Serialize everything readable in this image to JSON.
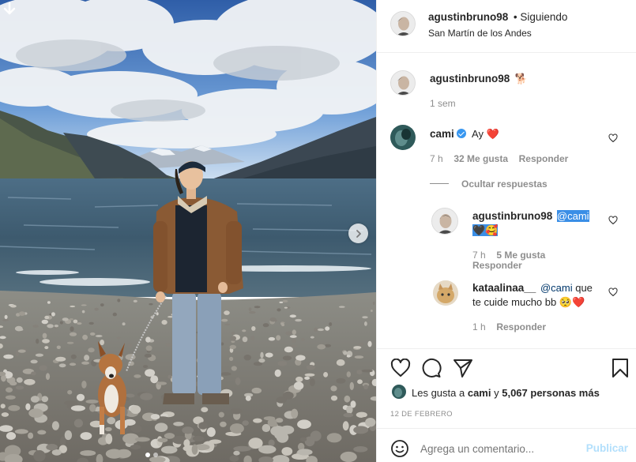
{
  "post": {
    "username": "agustinbruno98",
    "follow_status": "• Siguiendo",
    "location": "San Martín de los Andes",
    "caption_emoji": "🐕",
    "caption_time": "1 sem"
  },
  "comments": [
    {
      "username": "cami",
      "verified": true,
      "text": "Ay",
      "emoji": "❤️",
      "time": "7 h",
      "likes": "32 Me gusta",
      "reply_label": "Responder"
    }
  ],
  "hide_replies_label": "Ocultar respuestas",
  "replies": [
    {
      "username": "agustinbruno98",
      "mention": "@cami",
      "emoji": "🖤🥰",
      "time": "7 h",
      "likes": "5 Me gusta",
      "reply_label": "Responder"
    },
    {
      "username": "kataalinaa__",
      "mention": "@cami",
      "text_line1_suffix": "que",
      "text_line2": "te cuide mucho bb",
      "emoji": "🥺❤️",
      "time": "1 h",
      "reply_label": "Responder"
    }
  ],
  "likes_line": {
    "prefix": "Les gusta a",
    "first_user": "cami",
    "middle": "y",
    "others": "5,067 personas más"
  },
  "date": "12 DE FEBRERO",
  "comment_input": {
    "placeholder": "Agrega un comentario...",
    "publish_label": "Publicar"
  },
  "icons": {
    "download": "download-arrow-icon",
    "next": "chevron-right-icon",
    "like": "heart-icon",
    "comment": "comment-bubble-icon",
    "share": "paper-plane-icon",
    "save": "bookmark-icon",
    "emoji": "smiley-icon"
  },
  "colors": {
    "accent": "#3897f0",
    "publish_disabled": "#b2dffc",
    "muted": "#8e8e8e",
    "mention": "#00376b",
    "heart": "#ed4956"
  },
  "carousel": {
    "slides": 2,
    "active": 1
  }
}
